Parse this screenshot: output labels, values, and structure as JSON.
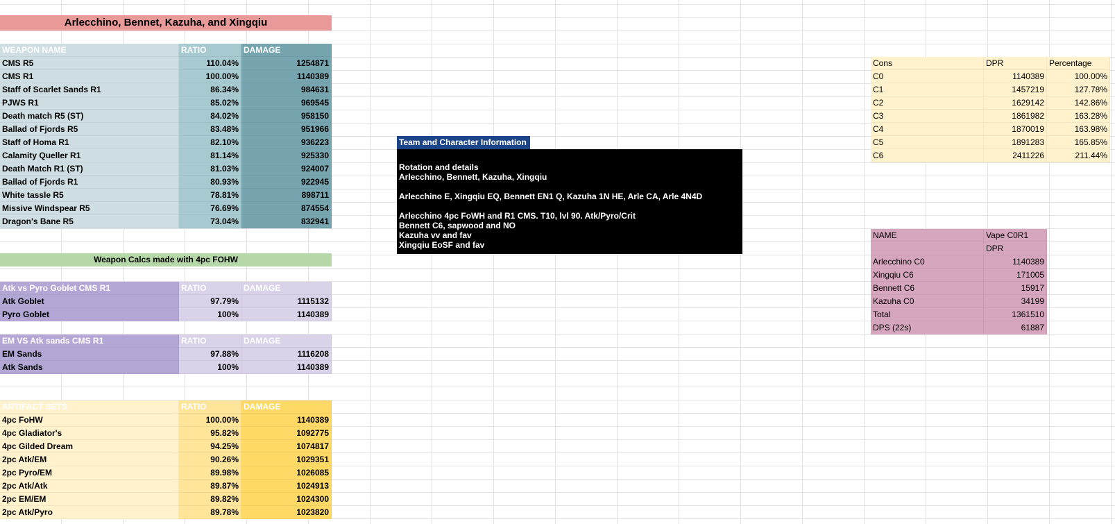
{
  "title": "Arlecchino, Bennet, Kazuha, and Xingqiu",
  "weapons": {
    "headers": [
      "WEAPON NAME",
      "RATIO",
      "DAMAGE"
    ],
    "rows": [
      {
        "name": "CMS R5",
        "ratio": "110.04%",
        "damage": "1254871"
      },
      {
        "name": "CMS R1",
        "ratio": "100.00%",
        "damage": "1140389"
      },
      {
        "name": "Staff of Scarlet Sands R1",
        "ratio": "86.34%",
        "damage": "984631"
      },
      {
        "name": "PJWS R1",
        "ratio": "85.02%",
        "damage": "969545"
      },
      {
        "name": "Death match R5 (ST)",
        "ratio": "84.02%",
        "damage": "958150"
      },
      {
        "name": "Ballad of Fjords R5",
        "ratio": "83.48%",
        "damage": "951966"
      },
      {
        "name": "Staff of Homa R1",
        "ratio": "82.10%",
        "damage": "936223"
      },
      {
        "name": "Calamity Queller R1",
        "ratio": "81.14%",
        "damage": "925330"
      },
      {
        "name": "Death Match R1 (ST)",
        "ratio": "81.03%",
        "damage": "924007"
      },
      {
        "name": "Ballad of Fjords R1",
        "ratio": "80.93%",
        "damage": "922945"
      },
      {
        "name": "White tassle R5",
        "ratio": "78.81%",
        "damage": "898711"
      },
      {
        "name": "Missive Windspear R5",
        "ratio": "76.69%",
        "damage": "874554"
      },
      {
        "name": "Dragon's Bane R5",
        "ratio": "73.04%",
        "damage": "832941"
      }
    ]
  },
  "weapon_note": "Weapon Calcs made with 4pc FOHW",
  "goblet": {
    "headers": [
      "Atk vs Pyro Goblet CMS R1",
      "RATIO",
      "DAMAGE"
    ],
    "rows": [
      {
        "name": "Atk Goblet",
        "ratio": "97.79%",
        "damage": "1115132"
      },
      {
        "name": "Pyro Goblet",
        "ratio": "100%",
        "damage": "1140389"
      }
    ]
  },
  "sands": {
    "headers": [
      "EM VS Atk sands CMS R1",
      "RATIO",
      "DAMAGE"
    ],
    "rows": [
      {
        "name": "EM Sands",
        "ratio": "97.88%",
        "damage": "1116208"
      },
      {
        "name": "Atk Sands",
        "ratio": "100%",
        "damage": "1140389"
      }
    ]
  },
  "artifacts": {
    "headers": [
      "ARTIFACT SETS",
      "RATIO",
      "DAMAGE"
    ],
    "rows": [
      {
        "name": "4pc FoHW",
        "ratio": "100.00%",
        "damage": "1140389"
      },
      {
        "name": "4pc Gladiator's",
        "ratio": "95.82%",
        "damage": "1092775"
      },
      {
        "name": "4pc Gilded Dream",
        "ratio": "94.25%",
        "damage": "1074817"
      },
      {
        "name": "2pc Atk/EM",
        "ratio": "90.26%",
        "damage": "1029351"
      },
      {
        "name": "2pc Pyro/EM",
        "ratio": "89.98%",
        "damage": "1026085"
      },
      {
        "name": "2pc Atk/Atk",
        "ratio": "89.87%",
        "damage": "1024913"
      },
      {
        "name": "2pc EM/EM",
        "ratio": "89.82%",
        "damage": "1024300"
      },
      {
        "name": "2pc Atk/Pyro",
        "ratio": "89.78%",
        "damage": "1023820"
      }
    ]
  },
  "team_info": {
    "header": "Team and Character Information",
    "rotation_title": "Rotation and details",
    "team": "Arlecchino, Bennett, Kazuha, Xingqiu",
    "rotation": "Arlecchino E, Xingqiu EQ, Bennett EN1 Q, Kazuha 1N HE, Arle CA, Arle 4N4D",
    "builds": [
      "Arlecchino 4pc FoWH and R1 CMS. T10, lvl 90. Atk/Pyro/Crit",
      "Bennett C6, sapwood and NO",
      "Kazuha vv and fav",
      "Xingqiu EoSF and fav"
    ]
  },
  "cons": {
    "headers": [
      "Cons",
      "DPR",
      "Percentage"
    ],
    "rows": [
      {
        "name": "C0",
        "dpr": "1140389",
        "pct": "100.00%"
      },
      {
        "name": "C1",
        "dpr": "1457219",
        "pct": "127.78%"
      },
      {
        "name": "C2",
        "dpr": "1629142",
        "pct": "142.86%"
      },
      {
        "name": "C3",
        "dpr": "1861982",
        "pct": "163.28%"
      },
      {
        "name": "C4",
        "dpr": "1870019",
        "pct": "163.98%"
      },
      {
        "name": "C5",
        "dpr": "1891283",
        "pct": "165.85%"
      },
      {
        "name": "C6",
        "dpr": "2411226",
        "pct": "211.44%"
      }
    ]
  },
  "damage_breakdown": {
    "header_name": "NAME",
    "header_col": "Vape C0R1",
    "sub_header": "DPR",
    "rows": [
      {
        "name": "Arlecchino C0",
        "value": "1140389"
      },
      {
        "name": "Xingqiu C6",
        "value": "171005"
      },
      {
        "name": "Bennett C6",
        "value": "15917"
      },
      {
        "name": "Kazuha C0",
        "value": "34199"
      },
      {
        "name": "Total",
        "value": "1361510"
      },
      {
        "name": "DPS (22s)",
        "value": "61887"
      }
    ]
  }
}
